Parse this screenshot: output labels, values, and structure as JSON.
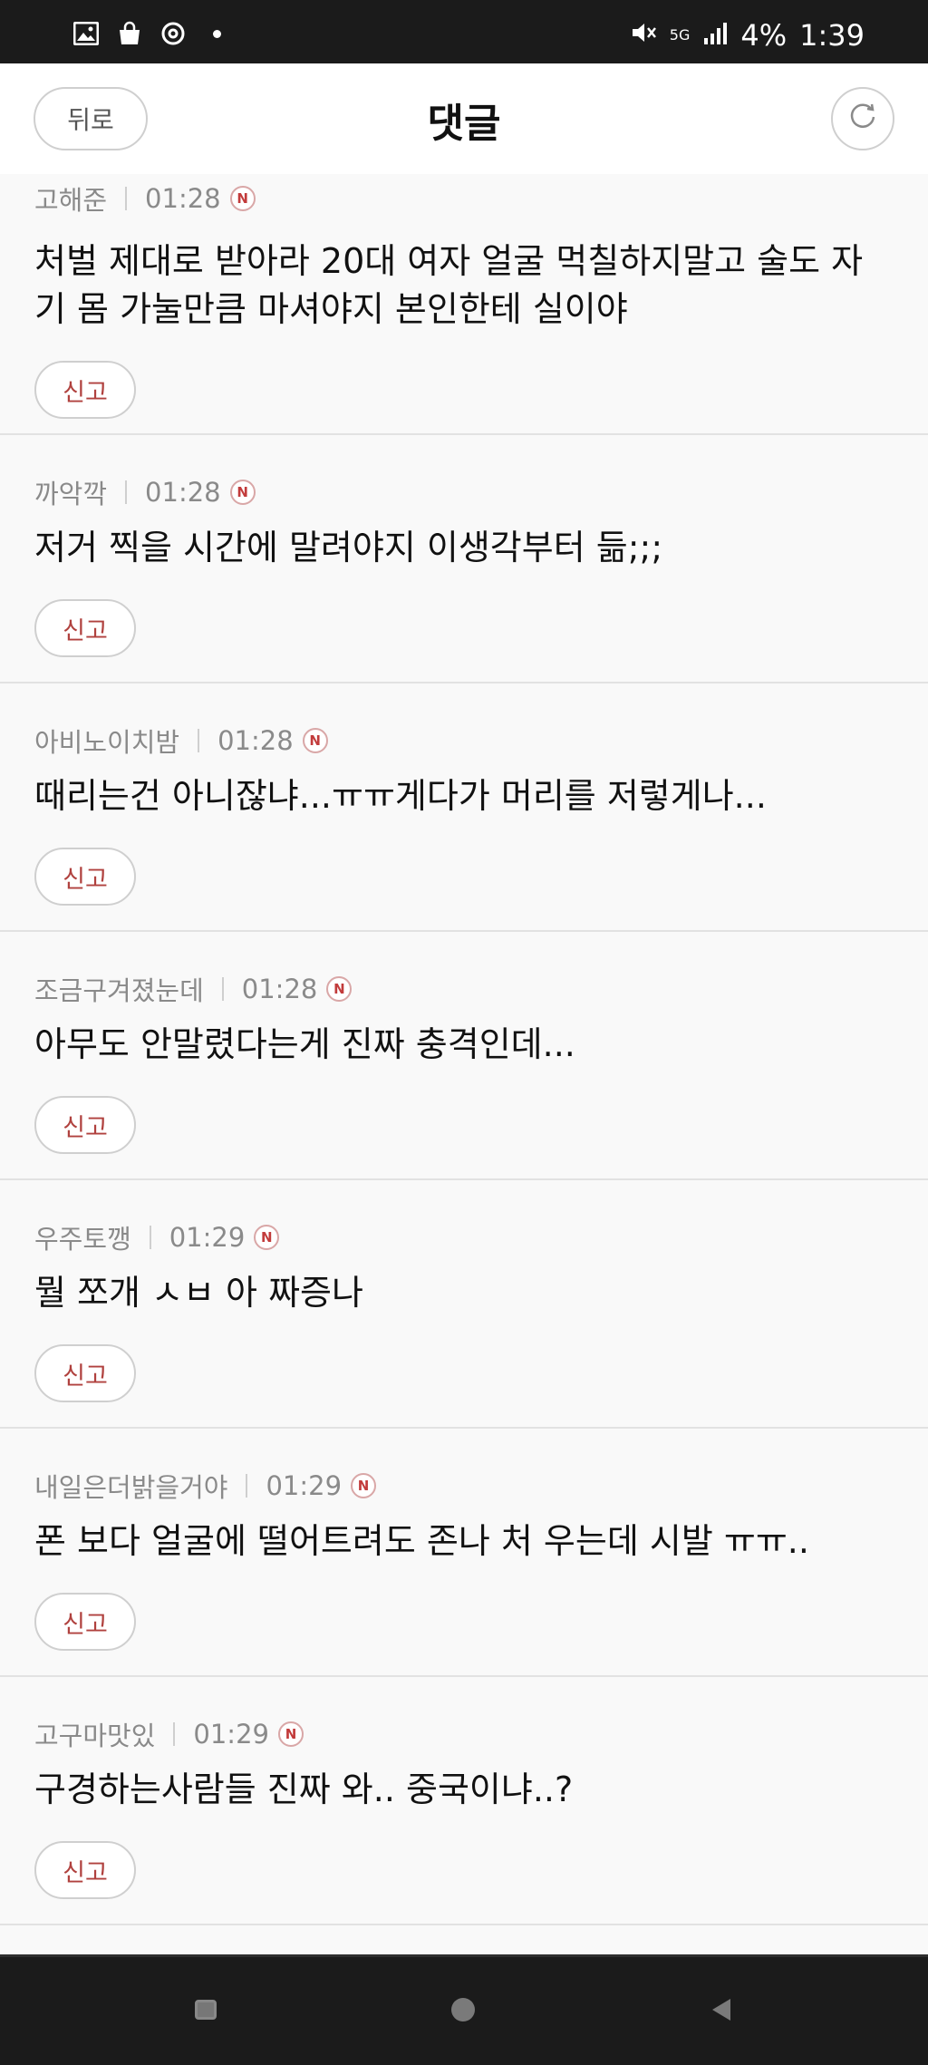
{
  "status_bar": {
    "icons_left": [
      "gallery-icon",
      "bag-icon",
      "sync-icon",
      "dot-icon"
    ],
    "network": "5G",
    "battery": "4%",
    "time": "1:39"
  },
  "header": {
    "back_label": "뒤로",
    "title": "댓글"
  },
  "comments": [
    {
      "author": "고해준",
      "time": "01:28",
      "badge": "N",
      "text": "처벌 제대로 받아라 20대 여자 얼굴 먹칠하지말고 술도 자기 몸 가눌만큼 마셔야지 본인한테 실이야",
      "report_label": "신고"
    },
    {
      "author": "까악깍",
      "time": "01:28",
      "badge": "N",
      "text": "저거 찍을 시간에 말려야지 이생각부터 듦;;;",
      "report_label": "신고"
    },
    {
      "author": "아비노이치밤",
      "time": "01:28",
      "badge": "N",
      "text": "때리는건 아니잖냐...ㅠㅠ게다가 머리를 저렇게나...",
      "report_label": "신고"
    },
    {
      "author": "조금구겨졌눈데",
      "time": "01:28",
      "badge": "N",
      "text": "아무도 안말렸다는게 진짜 충격인데...",
      "report_label": "신고"
    },
    {
      "author": "우주토깽",
      "time": "01:29",
      "badge": "N",
      "text": "뭘 쪼개 ㅅㅂ 아 짜증나",
      "report_label": "신고"
    },
    {
      "author": "내일은더밝을거야",
      "time": "01:29",
      "badge": "N",
      "text": "폰 보다 얼굴에 떨어트려도 존나 처 우는데 시발 ㅠㅠ..",
      "report_label": "신고"
    },
    {
      "author": "고구마맛있",
      "time": "01:29",
      "badge": "N",
      "text": "구경하는사람들 진짜 와.. 중국이냐..?",
      "report_label": "신고"
    }
  ],
  "nav_bar": {
    "icons": [
      "recents-icon",
      "home-icon",
      "back-icon"
    ]
  }
}
